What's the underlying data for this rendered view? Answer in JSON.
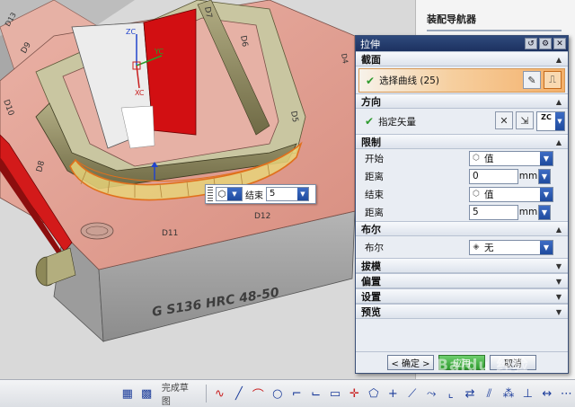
{
  "navigator": {
    "title": "装配导航器"
  },
  "viewport": {
    "part_engraving": "G S136 HRC 48-50",
    "triad_labels": [
      "ZC",
      "YC",
      "XC"
    ],
    "face_labels": [
      "D10",
      "D9",
      "D8",
      "D7",
      "D6",
      "D5",
      "D11",
      "D12",
      "D13",
      "D4"
    ],
    "floating_input": {
      "label": "结束",
      "value": "5"
    }
  },
  "dialog": {
    "title": "拉伸",
    "sections": {
      "section_curve": {
        "header": "截面",
        "select_curve": "选择曲线 (25)"
      },
      "section_direction": {
        "header": "方向",
        "specify_vector": "指定矢量",
        "vector_option": "ZC"
      },
      "section_limits": {
        "header": "限制",
        "start_label": "开始",
        "start_option": "值",
        "start_distance_label": "距离",
        "start_distance_value": "0",
        "end_label": "结束",
        "end_option": "值",
        "end_distance_label": "距离",
        "end_distance_value": "5",
        "unit": "mm"
      },
      "section_boolean": {
        "header": "布尔",
        "boolean_label": "布尔",
        "boolean_option": "无"
      },
      "collapsed": [
        "拔模",
        "偏置",
        "设置",
        "预览"
      ]
    },
    "buttons": {
      "ok": "< 确定 >",
      "apply": "应用",
      "cancel": "取消"
    }
  },
  "toolbar": {
    "sketch_label": "完成草图"
  },
  "watermark": "Baidu 经验"
}
